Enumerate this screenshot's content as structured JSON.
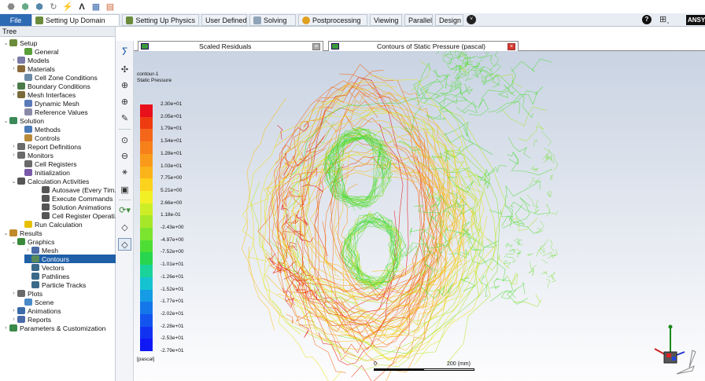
{
  "ribbon": {
    "tabs": [
      {
        "label": "File"
      },
      {
        "label": "Setting Up Domain"
      },
      {
        "label": "Setting Up Physics"
      },
      {
        "label": "User Defined"
      },
      {
        "label": "Solving"
      },
      {
        "label": "Postprocessing"
      },
      {
        "label": "Viewing"
      },
      {
        "label": "Parallel"
      },
      {
        "label": "Design"
      }
    ],
    "brand": "ANSY"
  },
  "tree": {
    "header": "Tree",
    "items": [
      {
        "label": "Setup"
      },
      {
        "label": "General"
      },
      {
        "label": "Models"
      },
      {
        "label": "Materials"
      },
      {
        "label": "Cell Zone Conditions"
      },
      {
        "label": "Boundary Conditions"
      },
      {
        "label": "Mesh Interfaces"
      },
      {
        "label": "Dynamic Mesh"
      },
      {
        "label": "Reference Values"
      },
      {
        "label": "Solution"
      },
      {
        "label": "Methods"
      },
      {
        "label": "Controls"
      },
      {
        "label": "Report Definitions"
      },
      {
        "label": "Monitors"
      },
      {
        "label": "Cell Registers"
      },
      {
        "label": "Initialization"
      },
      {
        "label": "Calculation Activities"
      },
      {
        "label": "Autosave (Every Tim..."
      },
      {
        "label": "Execute Commands"
      },
      {
        "label": "Solution Animations"
      },
      {
        "label": "Cell Register Operati..."
      },
      {
        "label": "Run Calculation"
      },
      {
        "label": "Results"
      },
      {
        "label": "Graphics"
      },
      {
        "label": "Mesh"
      },
      {
        "label": "Contours"
      },
      {
        "label": "Vectors"
      },
      {
        "label": "Pathlines"
      },
      {
        "label": "Particle Tracks"
      },
      {
        "label": "Plots"
      },
      {
        "label": "Scene"
      },
      {
        "label": "Animations"
      },
      {
        "label": "Reports"
      },
      {
        "label": "Parameters & Customization"
      }
    ]
  },
  "graphics_tabs": [
    {
      "label": "Scaled Residuals"
    },
    {
      "label": "Contours of Static Pressure (pascal)"
    }
  ],
  "viewport": {
    "contour_name": "contour-1",
    "contour_var": "Static Pressure",
    "unit": "[pascal]",
    "legend": [
      "2.30e+01",
      "2.05e+01",
      "1.79e+01",
      "1.54e+01",
      "1.28e+01",
      "1.03e+01",
      "7.75e+00",
      "5.21e+00",
      "2.66e+00",
      "1.18e-01",
      "-2.43e+00",
      "-4.97e+00",
      "-7.52e+00",
      "-1.01e+01",
      "-1.26e+01",
      "-1.52e+01",
      "-1.77e+01",
      "-2.02e+01",
      "-2.28e+01",
      "-2.53e+01",
      "-2.79e+01"
    ],
    "legend_colors": [
      "#e8101a",
      "#ef3b10",
      "#f4661a",
      "#f7801b",
      "#f99a1a",
      "#fbb31a",
      "#fbd21c",
      "#f2f025",
      "#cdee26",
      "#a6e829",
      "#7be42f",
      "#4edd35",
      "#27d64e",
      "#1ad39a",
      "#15c3d0",
      "#159ce4",
      "#1477ea",
      "#1354ef",
      "#1232f2",
      "#1018f5",
      "#0808f8"
    ],
    "scale_start": "0",
    "scale_end": "200 (mm)"
  }
}
